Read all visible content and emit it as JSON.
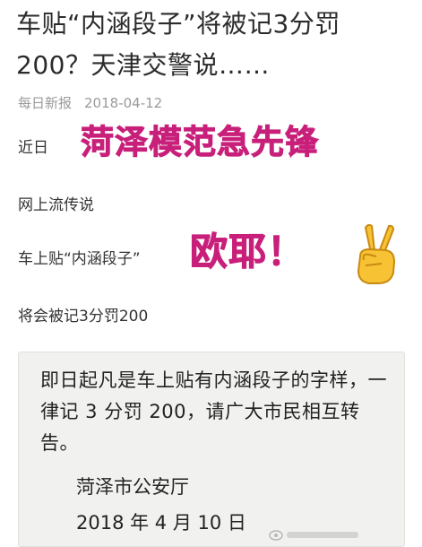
{
  "article": {
    "headline": "车贴“内涵段子”将被记3分罚200？天津交警说……",
    "source": "每日新报",
    "date": "2018-04-12"
  },
  "body": {
    "line1": "近日",
    "line2": "网上流传说",
    "line3": "车上贴“内涵段子”",
    "line4": "将会被记3分罚200"
  },
  "overlay": {
    "title_text": "菏泽模范急先锋",
    "exclaim_text": "欧耶！",
    "accent_color": "#c8207a",
    "icon": "victory-hand-icon"
  },
  "notice": {
    "paragraph": "即日起凡是车上贴有内涵段子的字样，一律记 3 分罚 200，请广大市民相互转告。",
    "issuer": "菏泽市公安厅",
    "date": "2018 年 4 月 10 日"
  }
}
